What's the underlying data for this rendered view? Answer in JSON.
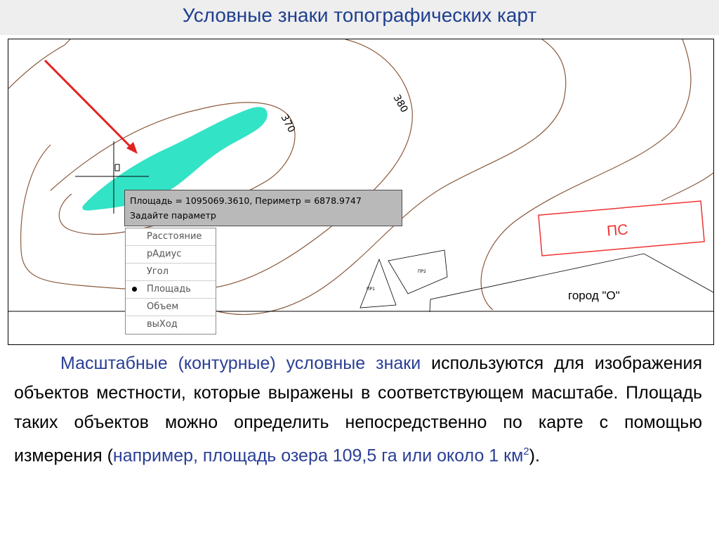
{
  "title": "Условные знаки топографических карт",
  "map": {
    "contour_labels": [
      "380",
      "370"
    ],
    "ps_label": "ПС",
    "pr1_label": "ПР1",
    "pr2_label": "ПР2",
    "city_label": "город \"О\"",
    "lake_color": "#33e3c6",
    "contour_color": "#8b5a3c",
    "arrow_color": "#e22222"
  },
  "tooltip": {
    "line1": "Площадь = 1095069.3610, Периметр = 6878.9747",
    "line2": "Задайте параметр"
  },
  "menu": {
    "items": [
      "Расстояние",
      "рАдиус",
      "Угол",
      "Площадь",
      "Объем",
      "выХод"
    ],
    "selected": "Площадь"
  },
  "text": {
    "p1_highlight": "Масштабные (контурные) условные знаки",
    "p1_rest": " используются для изображения объектов местности, которые выражены в соответствующем масштабе. Площадь таких объектов можно определить непосредственно по карте с помощью измерения (",
    "example": "например, площадь озера 109,5 га или около 1 км",
    "sup": "2",
    "tail": ")."
  }
}
